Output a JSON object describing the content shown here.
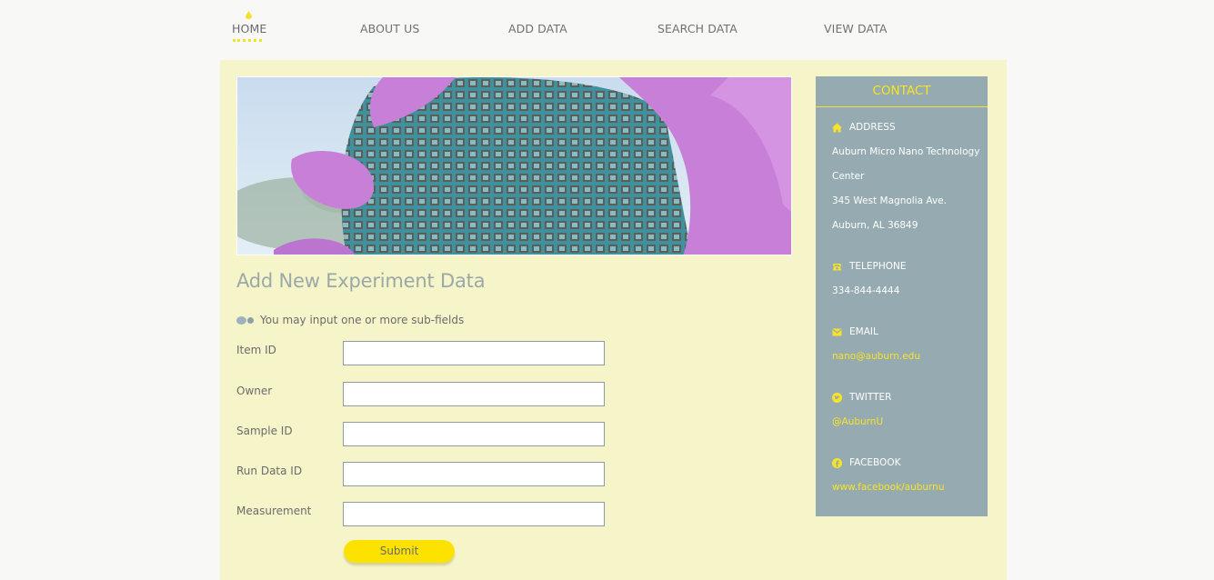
{
  "nav": {
    "items": [
      {
        "label": "HOME",
        "active": true
      },
      {
        "label": "ABOUT US"
      },
      {
        "label": "ADD DATA"
      },
      {
        "label": "SEARCH DATA"
      },
      {
        "label": "VIEW DATA"
      }
    ]
  },
  "main": {
    "title": "Add New Experiment Data",
    "note": "You may input one or more sub-fields",
    "fields": [
      {
        "label": "Item ID",
        "value": ""
      },
      {
        "label": "Owner",
        "value": ""
      },
      {
        "label": "Sample ID",
        "value": ""
      },
      {
        "label": "Run Data ID",
        "value": ""
      },
      {
        "label": "Measurement",
        "value": ""
      }
    ],
    "submit_label": "Submit"
  },
  "contact": {
    "title": "CONTACT",
    "address_heading": "ADDRESS",
    "address_lines": [
      "Auburn Micro Nano Technology",
      "Center",
      "345 West Magnolia Ave.",
      "Auburn, AL 36849"
    ],
    "telephone_heading": "TELEPHONE",
    "telephone": "334-844-4444",
    "email_heading": "EMAIL",
    "email": "nano@auburn.edu",
    "twitter_heading": "TWITTER",
    "twitter": "@AuburnU",
    "facebook_heading": "FACEBOOK",
    "facebook": "www.facebook/auburnu",
    "icons": [
      "home-icon",
      "phone-icon",
      "envelope-icon",
      "twitter-icon",
      "facebook-icon"
    ]
  },
  "colors": {
    "accent_yellow": "#fde200",
    "panel_bg": "#f6f5c9",
    "contact_bg": "#95abb1",
    "heading": "#9aa8a8"
  }
}
